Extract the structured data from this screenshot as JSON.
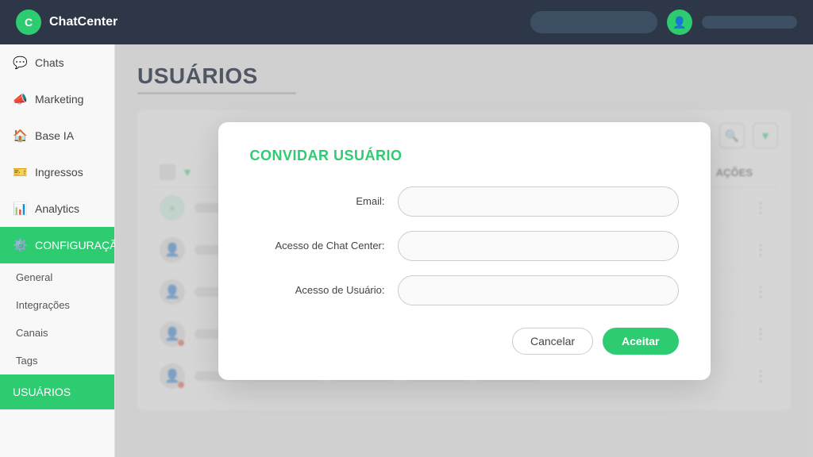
{
  "header": {
    "logo_letter": "C",
    "app_name": "ChatCenter"
  },
  "sidebar": {
    "items": [
      {
        "id": "chats",
        "label": "Chats",
        "icon": "💬",
        "active": false,
        "sub": false
      },
      {
        "id": "marketing",
        "label": "Marketing",
        "icon": "📣",
        "active": false,
        "sub": false
      },
      {
        "id": "base-ia",
        "label": "Base IA",
        "icon": "🏠",
        "active": false,
        "sub": false
      },
      {
        "id": "ingressos",
        "label": "Ingressos",
        "icon": "🎫",
        "active": false,
        "sub": false
      },
      {
        "id": "analytics",
        "label": "Analytics",
        "icon": "📊",
        "active": false,
        "sub": false
      },
      {
        "id": "configuracao",
        "label": "CONFIGURAÇÃO",
        "icon": "⚙️",
        "active": true,
        "sub": false
      },
      {
        "id": "general",
        "label": "General",
        "icon": "",
        "active": false,
        "sub": true
      },
      {
        "id": "integracoes",
        "label": "Integrações",
        "icon": "",
        "active": false,
        "sub": true
      },
      {
        "id": "canais",
        "label": "Canais",
        "icon": "",
        "active": false,
        "sub": true
      },
      {
        "id": "tags",
        "label": "Tags",
        "icon": "",
        "active": false,
        "sub": true
      },
      {
        "id": "usuarios",
        "label": "USUÁRIOS",
        "icon": "",
        "active": true,
        "sub": true,
        "usuarios": true
      }
    ]
  },
  "main": {
    "page_title": "USUÁRIOS"
  },
  "table": {
    "acoes_label": "AÇÕES",
    "rows": [
      {
        "id": 1,
        "has_avatar": true,
        "avatar_type": "normal"
      },
      {
        "id": 2,
        "has_avatar": true,
        "avatar_type": "normal"
      },
      {
        "id": 3,
        "has_avatar": true,
        "avatar_type": "normal"
      },
      {
        "id": 4,
        "has_avatar": true,
        "avatar_type": "warning"
      },
      {
        "id": 5,
        "has_avatar": true,
        "avatar_type": "warning"
      }
    ]
  },
  "modal": {
    "title": "CONVIDAR USUÁRIO",
    "fields": [
      {
        "id": "email",
        "label": "Email:",
        "placeholder": ""
      },
      {
        "id": "chat-center-access",
        "label": "Acesso de Chat Center:",
        "placeholder": ""
      },
      {
        "id": "user-access",
        "label": "Acesso de Usuário:",
        "placeholder": ""
      }
    ],
    "cancel_label": "Cancelar",
    "accept_label": "Aceitar"
  }
}
